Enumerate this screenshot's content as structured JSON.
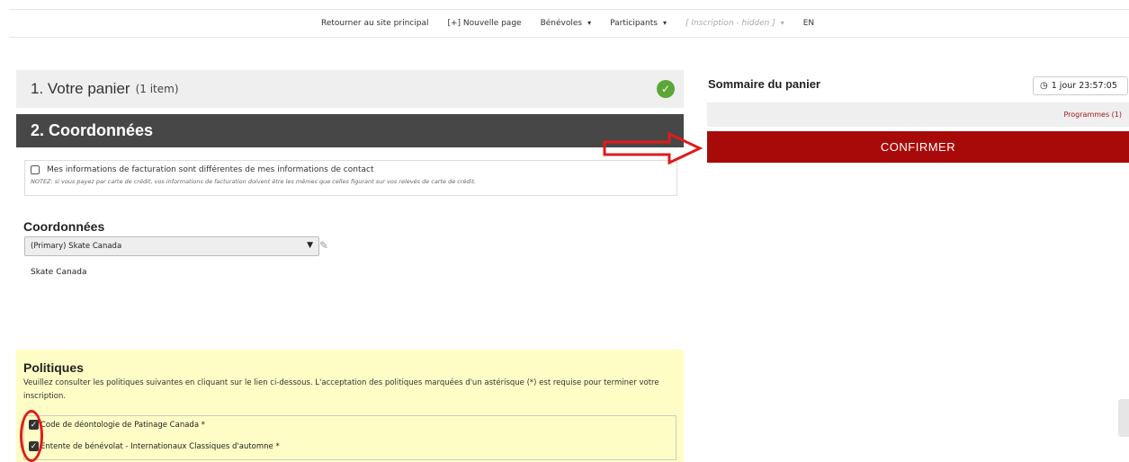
{
  "nav": {
    "items": [
      {
        "label": "Retourner au site principal",
        "caret": false,
        "muted": false
      },
      {
        "label": "[+] Nouvelle page",
        "caret": false,
        "muted": false
      },
      {
        "label": "Bénévoles",
        "caret": true,
        "muted": false
      },
      {
        "label": "Participants",
        "caret": true,
        "muted": false
      },
      {
        "label": "[ Inscription - hidden ]",
        "caret": true,
        "muted": true
      },
      {
        "label": "EN",
        "caret": false,
        "muted": false
      }
    ]
  },
  "step1": {
    "title": "1. Votre panier",
    "count": "(1 item)",
    "icon": "check-circle-icon"
  },
  "step2": {
    "title": "2. Coordonnées"
  },
  "billing": {
    "checkbox_label": "Mes informations de facturation sont différentes de mes informations de contact",
    "note": "NOTEZ: si vous payez par carte de crédit, vos informations de facturation doivent être les mêmes que celles figurant sur vos relevés de carte de crédit."
  },
  "coordinates": {
    "heading": "Coordonnées",
    "selected": "(Primary) Skate Canada",
    "name": "Skate Canada"
  },
  "policies": {
    "heading": "Politiques",
    "description": "Veuillez consulter les politiques suivantes en cliquant sur le lien ci-dessous. L'acceptation des politiques marquées d'un astérisque (*) est requise pour terminer votre inscription.",
    "items": [
      {
        "label": "Code de déontologie de Patinage Canada *",
        "checked": true
      },
      {
        "label": "Entente de bénévolat - Internationaux Classiques d'automne *",
        "checked": true
      }
    ]
  },
  "summary": {
    "title": "Sommaire du panier",
    "timer": "1 jour 23:57:05",
    "programs": "Programmes (1)",
    "confirm_label": "CONFIRMER"
  },
  "colors": {
    "accent": "#a80a0a",
    "success": "#5aa637",
    "annotation": "#e01b1b"
  }
}
